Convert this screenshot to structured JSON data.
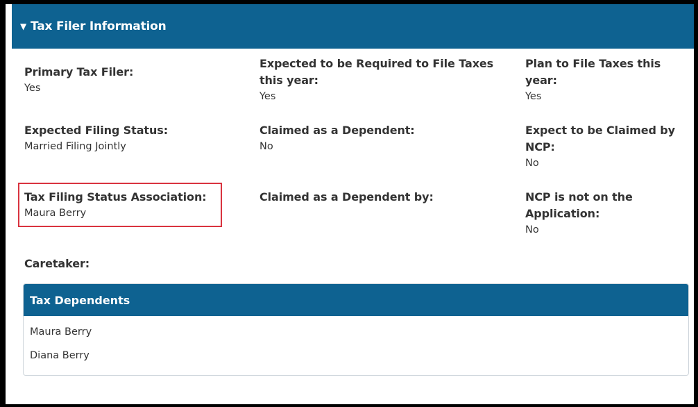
{
  "panel": {
    "caret_icon": "caret-down-icon",
    "title": "Tax Filer Information"
  },
  "fields": {
    "primary_tax_filer": {
      "label": "Primary Tax Filer:",
      "value": "Yes"
    },
    "expected_required": {
      "label_line1": "Expected to be Required to File Taxes",
      "label_line2": "this year:",
      "value": "Yes"
    },
    "plan_to_file": {
      "label_line1": "Plan to File Taxes this",
      "label_line2": "year:",
      "value": "Yes"
    },
    "expected_filing_status": {
      "label": "Expected Filing Status:",
      "value": "Married Filing Jointly"
    },
    "claimed_as_dependent": {
      "label": "Claimed as a Dependent:",
      "value": "No"
    },
    "expect_claimed_ncp": {
      "label_line1": "Expect to be Claimed by",
      "label_line2": "NCP:",
      "value": "No"
    },
    "tax_filing_status_association": {
      "label": "Tax Filing Status Association:",
      "value": "Maura Berry"
    },
    "claimed_as_dependent_by": {
      "label": "Claimed as a Dependent by:",
      "value": ""
    },
    "ncp_not_on_application": {
      "label_line1": "NCP is not on the",
      "label_line2": "Application:",
      "value": "No"
    },
    "caretaker": {
      "label": "Caretaker:",
      "value": ""
    }
  },
  "tax_dependents": {
    "title": "Tax Dependents",
    "items": [
      "Maura Berry",
      "Diana Berry"
    ]
  },
  "colors": {
    "header_bg": "#0e6291",
    "highlight_border": "#d9333f"
  }
}
